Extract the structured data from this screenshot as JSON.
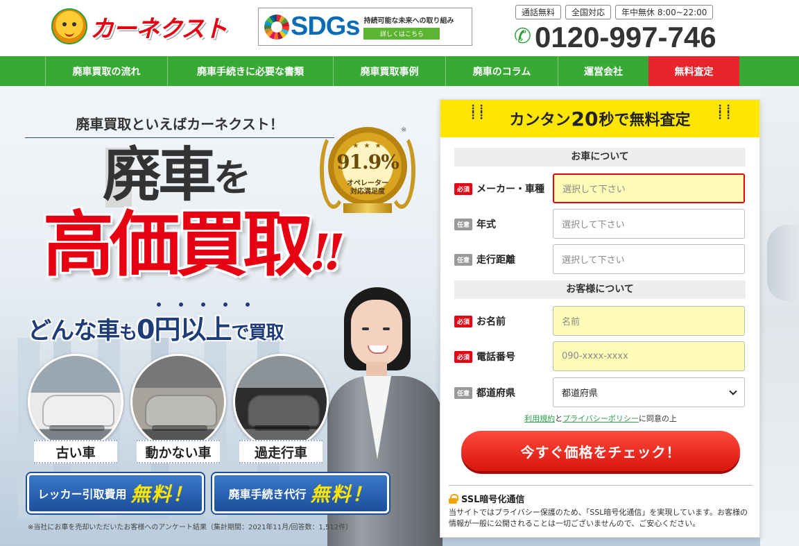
{
  "header": {
    "logo_text": "カーネクスト",
    "sdgs": {
      "title": "SDGs",
      "subtitle": "持続可能な未来への取り組み",
      "button": "詳しくはこちら"
    },
    "tags": [
      "通話無料",
      "全国対応",
      "年中無休 8:00~22:00"
    ],
    "phone": "0120-997-746"
  },
  "nav": {
    "items": [
      {
        "label": "廃車買取の流れ",
        "width": 176
      },
      {
        "label": "廃車手続きに必要な書類",
        "width": 239
      },
      {
        "label": "廃車買取事例",
        "width": 162
      },
      {
        "label": "廃車のコラム",
        "width": 162
      },
      {
        "label": "運営会社",
        "width": 131
      },
      {
        "label": "無料査定",
        "width": 131
      }
    ]
  },
  "hero": {
    "catch": "廃車買取といえばカーネクスト！",
    "note_mark": "※",
    "headline1": "廃車",
    "headline1_particle": "を",
    "headline2": "高価買取",
    "headline2_mark": "!!",
    "sub_part1": "どんな車",
    "sub_part2": "も",
    "sub_part3": "0円以上",
    "sub_part4": "で買取",
    "medal": {
      "stars": "★ ★ ★",
      "percent": "91.9%",
      "label1": "オペレーター",
      "label2": "対応満足度"
    },
    "cars": [
      {
        "label": "古い車"
      },
      {
        "label": "動かない車"
      },
      {
        "label": "過走行車"
      }
    ],
    "badges": [
      {
        "text": "レッカー引取費用",
        "yellow": "無料！"
      },
      {
        "text": "廃車手続き代行",
        "yellow": "無料！"
      }
    ],
    "footnote": "※当社にお車を売却いただいたお客様へのアンケート結果（集計期間：2021年11月/回答数：1,512件）"
  },
  "form": {
    "head_pre": "カンタン",
    "head_num": "20",
    "head_post": "秒で無料査定",
    "section_car": "お車について",
    "section_customer": "お客様について",
    "fields": [
      {
        "badge": "必須",
        "label": "メーカー・車種",
        "placeholder": "選択して下さい"
      },
      {
        "badge": "任意",
        "label": "年式",
        "placeholder": "選択して下さい"
      },
      {
        "badge": "任意",
        "label": "走行距離",
        "placeholder": "選択して下さい"
      },
      {
        "badge": "必須",
        "label": "お名前",
        "placeholder": "名前"
      },
      {
        "badge": "必須",
        "label": "電話番号",
        "placeholder": "090-xxxx-xxxx"
      },
      {
        "badge": "任意",
        "label": "都道府県",
        "value": "都道府県"
      }
    ],
    "agree_link1": "利用規約",
    "agree_mid": "と",
    "agree_link2": "プライバシーポリシー",
    "agree_post": "に同意の上",
    "submit": "今すぐ価格をチェック！",
    "ssl_title": "SSL暗号化通信",
    "ssl_text": "当サイトではプライバシー保護のため、「SSL暗号化通信」を実現しています。お客様の情報が一般に公開されることは一切ございませんので、ご安心ください。"
  },
  "colors": {
    "brand_green": "#39a935",
    "brand_red": "#e60012",
    "form_yellow": "#ffe600"
  }
}
